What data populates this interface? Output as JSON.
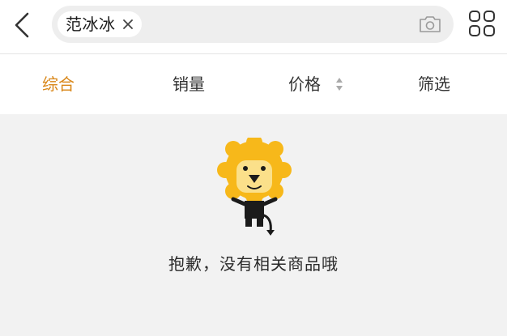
{
  "search": {
    "query": "范冰冰"
  },
  "icons": {
    "back": "chevron-left-icon",
    "clear": "close-icon",
    "camera": "camera-icon",
    "grid": "grid-view-icon",
    "sort": "sort-arrows-icon",
    "mascot": "lion-mascot-icon"
  },
  "tabs": [
    {
      "label": "综合",
      "active": true
    },
    {
      "label": "销量",
      "active": false
    },
    {
      "label": "价格",
      "active": false
    },
    {
      "label": "筛选",
      "active": false
    }
  ],
  "empty_state": {
    "message": "抱歉，没有相关商品哦"
  },
  "colors": {
    "accent": "#d98719",
    "mascot_yellow": "#f7b81a",
    "background": "#f2f2f2"
  }
}
